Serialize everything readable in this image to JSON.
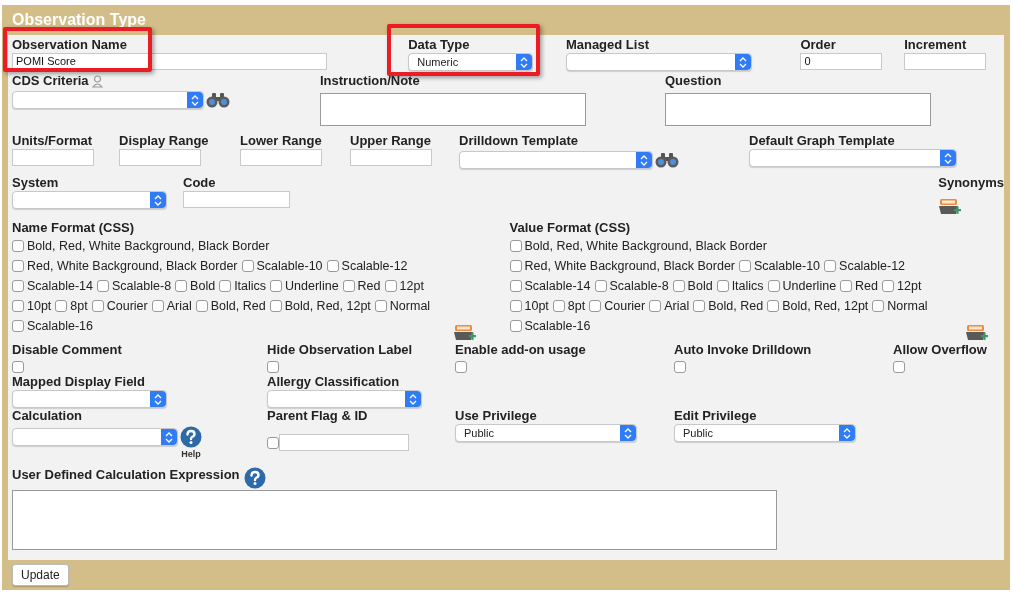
{
  "title": "Observation Type",
  "top_rows": [
    [
      {
        "kind": "input",
        "label": "Observation Name",
        "value": "POMI Score",
        "highlighted": true
      },
      {
        "kind": "select",
        "label": "Data Type",
        "value": "Numeric",
        "highlighted": true
      },
      {
        "kind": "select",
        "label": "Managed List",
        "highlighted": false
      },
      {
        "kind": "input",
        "label": "Order",
        "value": "0",
        "highlighted": false
      },
      {
        "kind": "input",
        "label": "Increment",
        "highlighted": false
      }
    ],
    [
      {
        "kind": "criteria-select",
        "label": "CDS Criteria"
      },
      {
        "kind": "textarea",
        "label": "Instruction/Note"
      },
      {
        "kind": "textarea",
        "label": "Question"
      }
    ],
    [
      {
        "kind": "input",
        "label": "Units/Format"
      },
      {
        "kind": "input",
        "label": "Display Range"
      },
      {
        "kind": "input",
        "label": "Lower Range"
      },
      {
        "kind": "input",
        "label": "Upper Range"
      },
      {
        "kind": "lookup-select",
        "label": "Drilldown Template"
      },
      {
        "kind": "select",
        "label": "Default Graph Template"
      }
    ],
    [
      {
        "kind": "select",
        "label": "System"
      },
      {
        "kind": "input",
        "label": "Code"
      },
      {
        "kind": "add-icon",
        "label": "Synonyms"
      }
    ]
  ],
  "formats": [
    {
      "label": "Name Format (CSS)",
      "options": [
        {
          "label": "Bold, Red, White Background, Black Border",
          "checked": false
        },
        {
          "label": "Red, White Background, Black Border",
          "checked": false
        },
        {
          "label": "Scalable-10",
          "checked": false
        },
        {
          "label": "Scalable-12",
          "checked": false
        },
        {
          "label": "Scalable-14",
          "checked": false
        },
        {
          "label": "Scalable-8",
          "checked": false
        },
        {
          "label": "Bold",
          "checked": false
        },
        {
          "label": "Italics",
          "checked": false
        },
        {
          "label": "Underline",
          "checked": false
        },
        {
          "label": "Red",
          "checked": false
        },
        {
          "label": "12pt",
          "checked": false
        },
        {
          "label": "10pt",
          "checked": false
        },
        {
          "label": "8pt",
          "checked": false
        },
        {
          "label": "Courier",
          "checked": false
        },
        {
          "label": "Arial",
          "checked": false
        },
        {
          "label": "Bold, Red",
          "checked": false
        },
        {
          "label": "Bold, Red, 12pt",
          "checked": false
        },
        {
          "label": "Normal",
          "checked": false
        },
        {
          "label": "Scalable-16",
          "checked": false
        }
      ]
    },
    {
      "label": "Value Format (CSS)",
      "options": [
        {
          "label": "Bold, Red, White Background, Black Border",
          "checked": false
        },
        {
          "label": "Red, White Background, Black Border",
          "checked": false
        },
        {
          "label": "Scalable-10",
          "checked": false
        },
        {
          "label": "Scalable-12",
          "checked": false
        },
        {
          "label": "Scalable-14",
          "checked": false
        },
        {
          "label": "Scalable-8",
          "checked": false
        },
        {
          "label": "Bold",
          "checked": false
        },
        {
          "label": "Italics",
          "checked": false
        },
        {
          "label": "Underline",
          "checked": false
        },
        {
          "label": "Red",
          "checked": false
        },
        {
          "label": "12pt",
          "checked": false
        },
        {
          "label": "10pt",
          "checked": false
        },
        {
          "label": "8pt",
          "checked": false
        },
        {
          "label": "Courier",
          "checked": false
        },
        {
          "label": "Arial",
          "checked": false
        },
        {
          "label": "Bold, Red",
          "checked": false
        },
        {
          "label": "Bold, Red, 12pt",
          "checked": false
        },
        {
          "label": "Normal",
          "checked": false
        },
        {
          "label": "Scalable-16",
          "checked": false
        }
      ]
    }
  ],
  "bottom_rows": [
    [
      {
        "kind": "checkbox",
        "label": "Disable Comment",
        "checked": false
      },
      {
        "kind": "checkbox",
        "label": "Hide Observation Label",
        "checked": false
      },
      {
        "kind": "checkbox",
        "label": "Enable add-on usage",
        "checked": false
      },
      {
        "kind": "checkbox",
        "label": "Auto Invoke Drilldown",
        "checked": false
      },
      {
        "kind": "checkbox",
        "label": "Allow Overflow",
        "checked": false
      }
    ],
    [
      {
        "kind": "select",
        "label": "Mapped Display Field"
      },
      {
        "kind": "select",
        "label": "Allergy Classification"
      }
    ],
    [
      {
        "kind": "help-select",
        "label": "Calculation",
        "help_label": "Help"
      },
      {
        "kind": "check-input",
        "label": "Parent Flag & ID",
        "checked": false
      },
      {
        "kind": "select",
        "label": "Use Privilege",
        "value": "Public"
      },
      {
        "kind": "select",
        "label": "Edit Privilege",
        "value": "Public"
      }
    ]
  ],
  "expression": {
    "label": "User Defined Calculation Expression"
  },
  "button": "Update"
}
